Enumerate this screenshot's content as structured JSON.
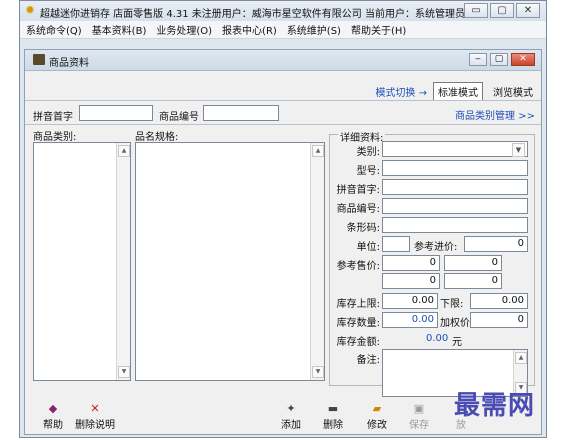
{
  "app": {
    "title": "超越迷你进销存 店面零售版 4.31  未注册用户：威海市星空软件有限公司  当前用户：系统管理员",
    "min_icon": "minimize-icon",
    "max_icon": "maximize-icon",
    "close_icon": "close-icon",
    "min_glyph": "▭",
    "max_glyph": "▢",
    "close_glyph": "✕"
  },
  "menu": [
    "系统命令(Q)",
    "基本资料(B)",
    "业务处理(O)",
    "报表中心(R)",
    "系统维护(S)",
    "帮助关于(H)"
  ],
  "window": {
    "title": "商品资料",
    "min_glyph": "‒",
    "max_glyph": "▢",
    "close_glyph": "✕"
  },
  "mode": {
    "switch_label": "模式切换 →",
    "standard": "标准模式",
    "browse": "浏览模式"
  },
  "filters": {
    "pinyin_label": "拼音首字",
    "pinyin_value": "",
    "code_label": "商品编号",
    "code_value": "",
    "category_manage": "商品类别管理 >>"
  },
  "lists": {
    "category_label": "商品类别:",
    "spec_label": "品名规格:"
  },
  "details": {
    "group_title": "详细资料:",
    "category": "类别:",
    "model": "型号:",
    "pinyin": "拼音首字:",
    "code": "商品编号:",
    "barcode": "条形码:",
    "unit": "单位:",
    "ref_purchase": "参考进价:",
    "ref_purchase_value": "0",
    "ref_sale": "参考售价:",
    "sale_values": [
      "0",
      "0",
      "0",
      "0"
    ],
    "stock_upper": "库存上限:",
    "stock_upper_value": "0.00",
    "stock_lower": "下限:",
    "stock_lower_value": "0.00",
    "stock_qty": "库存数量:",
    "stock_qty_value": "0.00",
    "weighted_price": "加权价",
    "weighted_price_value": "0",
    "stock_amount": "库存金额:",
    "stock_amount_value": "0.00",
    "stock_amount_unit": "元",
    "remarks": "备注:"
  },
  "toolbar": {
    "help": "帮助",
    "delete_desc": "删除说明",
    "add": "添加",
    "delete": "删除",
    "edit": "修改",
    "save": "保存",
    "save_disabled_tail": "放"
  },
  "watermark": "最需网"
}
